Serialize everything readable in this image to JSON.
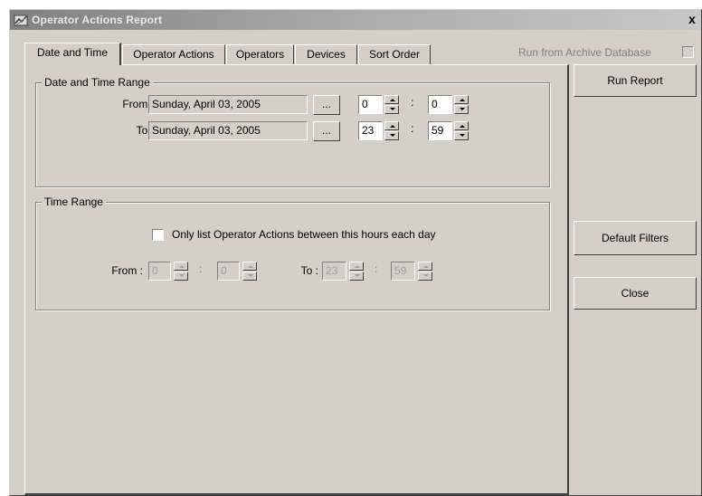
{
  "window": {
    "title": "Operator Actions Report",
    "icon": "report-app-icon",
    "close_label": "x"
  },
  "tabs": [
    {
      "label": "Date and Time",
      "active": true
    },
    {
      "label": "Operator Actions",
      "active": false
    },
    {
      "label": "Operators",
      "active": false
    },
    {
      "label": "Devices",
      "active": false
    },
    {
      "label": "Sort Order",
      "active": false
    }
  ],
  "archive": {
    "label": "Run from Archive Database",
    "checked": false
  },
  "date_time_range": {
    "legend": "Date and Time Range",
    "from_label": "From :",
    "from_date": "Sunday, April 03, 2005",
    "from_hour": "0",
    "from_minute": "0",
    "to_label": "To :",
    "to_date": "Sunday, April 03, 2005",
    "to_hour": "23",
    "to_minute": "59",
    "browse_label": "...",
    "separator": ":"
  },
  "time_range": {
    "legend": "Time Range",
    "checkbox_label": "Only list Operator Actions between this hours each day",
    "checked": false,
    "from_label": "From :",
    "from_hour": "0",
    "from_minute": "0",
    "to_label": "To :",
    "to_hour": "23",
    "to_minute": "59",
    "separator": ":"
  },
  "buttons": {
    "run_report": "Run Report",
    "default_filters": "Default Filters",
    "close": "Close"
  }
}
